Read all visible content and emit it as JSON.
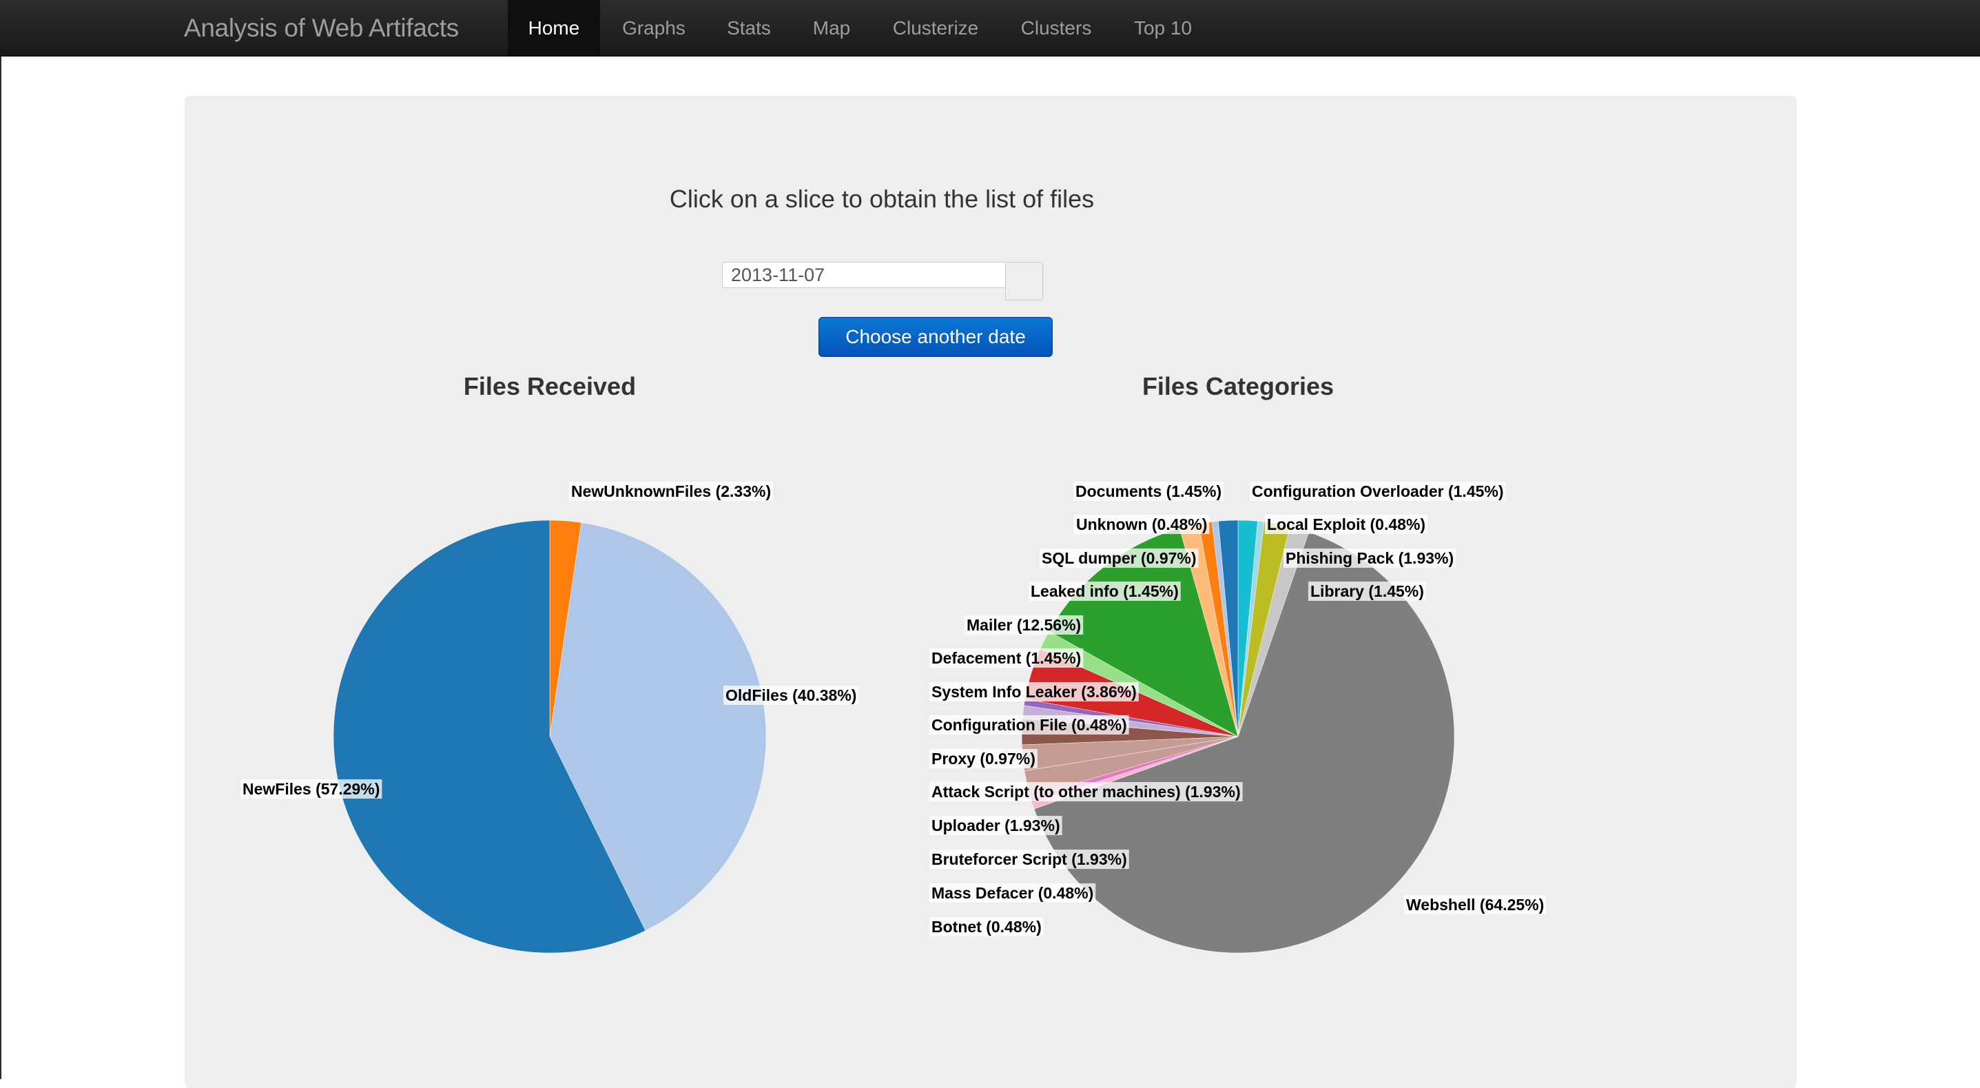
{
  "app": {
    "brand": "Analysis of Web Artifacts"
  },
  "nav": {
    "items": [
      {
        "label": "Home",
        "active": true
      },
      {
        "label": "Graphs"
      },
      {
        "label": "Stats"
      },
      {
        "label": "Map"
      },
      {
        "label": "Clusterize"
      },
      {
        "label": "Clusters"
      },
      {
        "label": "Top 10"
      }
    ]
  },
  "main": {
    "instructions": "Click on a slice to obtain the list of files",
    "date_value": "2013-11-07",
    "date_button_label": "Choose another date"
  },
  "chart_data": [
    {
      "type": "pie",
      "title": "Files Received",
      "slices": [
        {
          "label": "NewUnknownFiles",
          "percent": 2.33,
          "display": "NewUnknownFiles (2.33%)",
          "color": "#ff7f0e"
        },
        {
          "label": "OldFiles",
          "percent": 40.38,
          "display": "OldFiles (40.38%)",
          "color": "#aec7e8"
        },
        {
          "label": "NewFiles",
          "percent": 57.29,
          "display": "NewFiles (57.29%)",
          "color": "#1f77b4"
        }
      ]
    },
    {
      "type": "pie",
      "title": "Files Categories",
      "slices": [
        {
          "label": "Configuration Overloader",
          "percent": 1.45,
          "display": "Configuration Overloader (1.45%)",
          "color": "#17becf"
        },
        {
          "label": "Local Exploit",
          "percent": 0.48,
          "display": "Local Exploit (0.48%)",
          "color": "#9edae5"
        },
        {
          "label": "Phishing Pack",
          "percent": 1.93,
          "display": "Phishing Pack (1.93%)",
          "color": "#bcbd22"
        },
        {
          "label": "Library",
          "percent": 1.45,
          "display": "Library (1.45%)",
          "color": "#c7c7c7"
        },
        {
          "label": "Webshell",
          "percent": 64.25,
          "display": "Webshell (64.25%)",
          "color": "#7f7f7f"
        },
        {
          "label": "Botnet",
          "percent": 0.48,
          "display": "Botnet (0.48%)",
          "color": "#f7b6d2"
        },
        {
          "label": "Mass Defacer",
          "percent": 0.48,
          "display": "Mass Defacer (0.48%)",
          "color": "#e377c2"
        },
        {
          "label": "Bruteforcer Script",
          "percent": 1.93,
          "display": "Bruteforcer Script (1.93%)",
          "color": "#c49c94"
        },
        {
          "label": "Uploader",
          "percent": 1.93,
          "display": "Uploader (1.93%)",
          "color": "#c49c94"
        },
        {
          "label": "Attack Script (to other machines)",
          "percent": 1.93,
          "display": "Attack Script (to other machines) (1.93%)",
          "color": "#8c564b"
        },
        {
          "label": "Proxy",
          "percent": 0.97,
          "display": "Proxy (0.97%)",
          "color": "#c5b0d5"
        },
        {
          "label": "Configuration File",
          "percent": 0.48,
          "display": "Configuration File (0.48%)",
          "color": "#9467bd"
        },
        {
          "label": "System Info Leaker",
          "percent": 3.86,
          "display": "System Info Leaker (3.86%)",
          "color": "#d62728"
        },
        {
          "label": "Defacement",
          "percent": 1.45,
          "display": "Defacement (1.45%)",
          "color": "#98df8a"
        },
        {
          "label": "Mailer",
          "percent": 12.56,
          "display": "Mailer (12.56%)",
          "color": "#2ca02c"
        },
        {
          "label": "Leaked info",
          "percent": 1.45,
          "display": "Leaked info (1.45%)",
          "color": "#ffbb78"
        },
        {
          "label": "SQL dumper",
          "percent": 0.97,
          "display": "SQL dumper (0.97%)",
          "color": "#ff7f0e"
        },
        {
          "label": "Unknown",
          "percent": 0.48,
          "display": "Unknown (0.48%)",
          "color": "#aec7e8"
        },
        {
          "label": "Documents",
          "percent": 1.45,
          "display": "Documents (1.45%)",
          "color": "#1f77b4"
        }
      ]
    }
  ]
}
